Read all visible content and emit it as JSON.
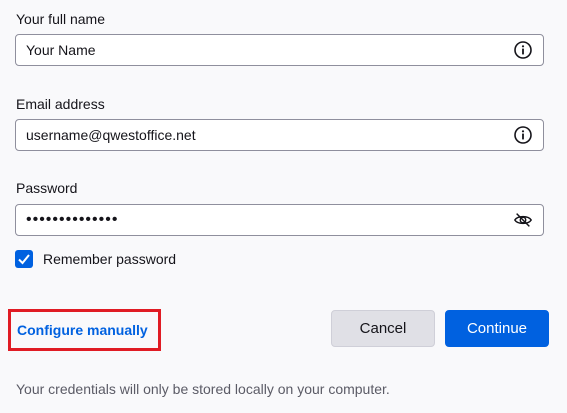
{
  "fields": {
    "full_name": {
      "label": "Your full name",
      "value": "Your Name",
      "placeholder": "Your Name"
    },
    "email": {
      "label": "Email address",
      "value": "username@qwestoffice.net",
      "placeholder": ""
    },
    "password": {
      "label": "Password",
      "value": "••••••••••••••"
    }
  },
  "remember_password": {
    "label": "Remember password",
    "checked": true
  },
  "links": {
    "configure_manually": "Configure manually"
  },
  "buttons": {
    "cancel": "Cancel",
    "continue": "Continue"
  },
  "footer_note": "Your credentials will only be stored locally on your computer.",
  "icons": {
    "name_info": "info-icon",
    "email_info": "info-icon",
    "password_toggle": "eye-slash-icon",
    "checkbox": "checkmark-icon"
  },
  "colors": {
    "accent": "#0061e0",
    "highlight_border": "#e01b24"
  }
}
